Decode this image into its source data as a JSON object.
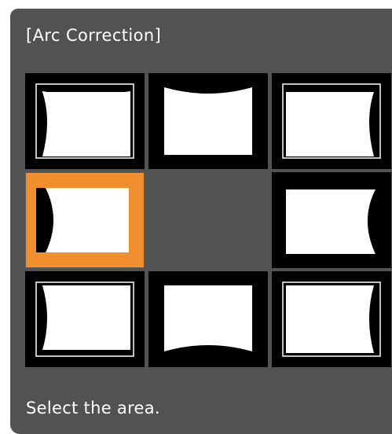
{
  "dialog": {
    "title": "[Arc Correction]",
    "hint": "Select the area."
  },
  "colors": {
    "panel": "#525252",
    "cell": "#000000",
    "selected": "#f18f2e",
    "screen": "#ffffff"
  },
  "areas": [
    {
      "id": "top-left",
      "selected": false
    },
    {
      "id": "top-center",
      "selected": false
    },
    {
      "id": "top-right",
      "selected": false
    },
    {
      "id": "middle-left",
      "selected": true
    },
    {
      "id": "center",
      "selected": false,
      "empty": true
    },
    {
      "id": "middle-right",
      "selected": false
    },
    {
      "id": "bottom-left",
      "selected": false
    },
    {
      "id": "bottom-center",
      "selected": false
    },
    {
      "id": "bottom-right",
      "selected": false
    }
  ]
}
